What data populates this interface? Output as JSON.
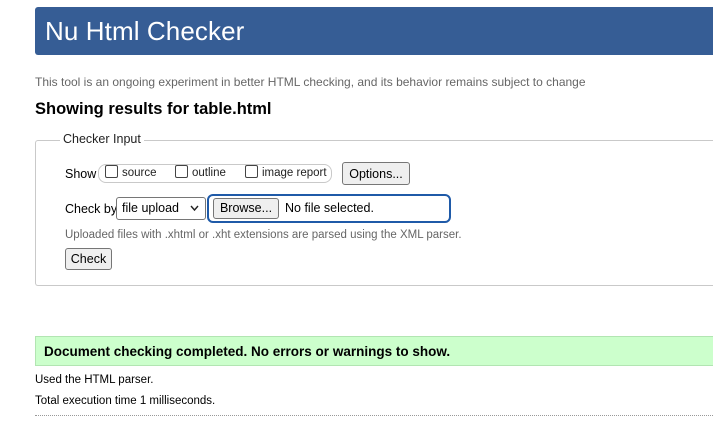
{
  "header": {
    "title": "Nu Html Checker"
  },
  "intro": "This tool is an ongoing experiment in better HTML checking, and its behavior remains subject to change",
  "showing": "Showing results for table.html",
  "checker": {
    "legend": "Checker Input",
    "show_label": "Show",
    "options": [
      {
        "label": "source",
        "checked": false
      },
      {
        "label": "outline",
        "checked": false
      },
      {
        "label": "image report",
        "checked": false
      }
    ],
    "options_button": "Options...",
    "checkby_label": "Check by",
    "checkby_value": "file upload",
    "browse_button": "Browse...",
    "file_status": "No file selected.",
    "note": "Uploaded files with .xhtml or .xht extensions are parsed using the XML parser.",
    "check_button": "Check"
  },
  "results": {
    "success": "Document checking completed. No errors or warnings to show.",
    "parser": "Used the HTML parser.",
    "time": "Total execution time 1 milliseconds."
  },
  "colors": {
    "header": "#365d95",
    "success_bg": "#ccffcc",
    "focus_ring": "#1f5aa8"
  }
}
